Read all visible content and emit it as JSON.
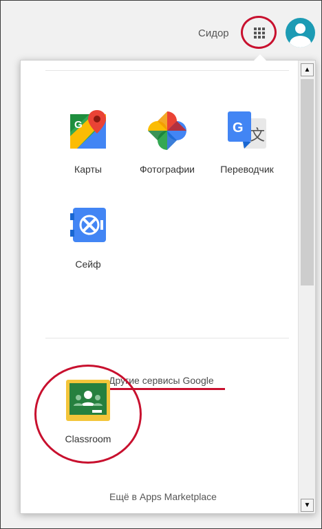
{
  "header": {
    "username": "Сидор",
    "apps_button_icon": "apps-grid-icon",
    "avatar_icon": "user-avatar-icon"
  },
  "apps": [
    {
      "label": "Карты",
      "icon": "google-maps-icon"
    },
    {
      "label": "Фотографии",
      "icon": "google-photos-icon"
    },
    {
      "label": "Переводчик",
      "icon": "google-translate-icon"
    },
    {
      "label": "Сейф",
      "icon": "google-vault-icon"
    }
  ],
  "more_services": "Другие сервисы Google",
  "installed": [
    {
      "label": "Classroom",
      "icon": "google-classroom-icon"
    }
  ],
  "marketplace": "Ещё в Apps Marketplace",
  "colors": {
    "annotation_red": "#c8102e",
    "avatar_bg": "#1c9bb4",
    "classroom_green": "#26803f",
    "classroom_frame": "#f3c53a"
  }
}
